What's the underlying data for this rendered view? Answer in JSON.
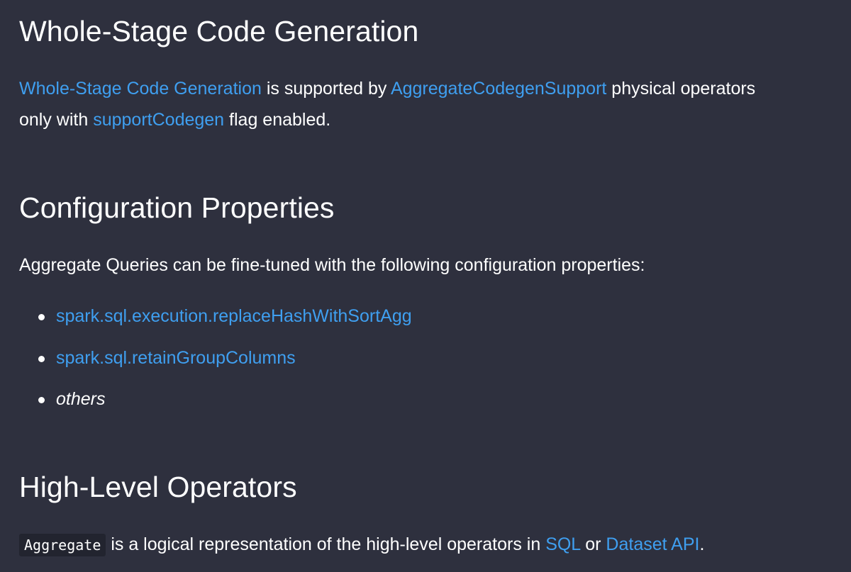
{
  "sections": {
    "codegen": {
      "heading": "Whole-Stage Code Generation",
      "para": {
        "link1": "Whole-Stage Code Generation",
        "text1": " is supported by ",
        "link2": "AggregateCodegenSupport",
        "text2": " physical operators",
        "text3": "only with ",
        "link3": "supportCodegen",
        "text4": " flag enabled."
      }
    },
    "config": {
      "heading": "Configuration Properties",
      "intro": "Aggregate Queries can be fine-tuned with the following configuration properties:",
      "items": [
        {
          "label": "spark.sql.execution.replaceHashWithSortAgg",
          "is_link": true
        },
        {
          "label": "spark.sql.retainGroupColumns",
          "is_link": true
        },
        {
          "label": "others",
          "is_link": false
        }
      ]
    },
    "operators": {
      "heading": "High-Level Operators",
      "para": {
        "code": "Aggregate",
        "text1": " is a logical representation of the high-level operators in ",
        "link1": "SQL",
        "text2": " or ",
        "link2": "Dataset API",
        "text3": "."
      }
    }
  },
  "colors": {
    "background": "#2e303e",
    "text": "#ffffff",
    "link": "#3f9ff0",
    "code_background": "#22242f"
  },
  "icons": {
    "list_bullet": "bullet-icon"
  }
}
